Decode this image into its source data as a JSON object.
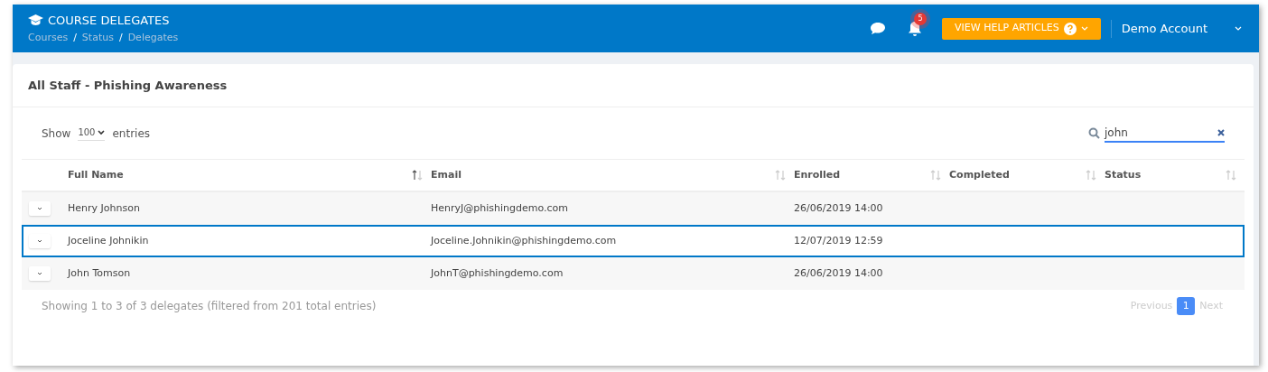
{
  "header": {
    "title": "COURSE DELEGATES",
    "breadcrumbs": [
      "Courses",
      "Status",
      "Delegates"
    ],
    "breadcrumb_separator": "/",
    "notifications": "5",
    "help_button": "VIEW HELP ARTICLES",
    "account": "Demo Account"
  },
  "card": {
    "title": "All Staff - Phishing Awareness"
  },
  "length": {
    "before": "Show",
    "value": "100",
    "after": "entries"
  },
  "search": {
    "value": "john"
  },
  "table": {
    "columns": [
      {
        "label": "Full Name",
        "sorted": true
      },
      {
        "label": "Email",
        "sorted": false
      },
      {
        "label": "Enrolled",
        "sorted": false
      },
      {
        "label": "Completed",
        "sorted": false
      },
      {
        "label": "Status",
        "sorted": false
      }
    ],
    "rows": [
      {
        "selected": false,
        "cells": [
          "Henry Johnson",
          "HenryJ@phishingdemo.com",
          "26/06/2019 14:00"
        ]
      },
      {
        "selected": true,
        "cells": [
          "Joceline Johnikin",
          "Joceline.Johnikin@phishingdemo.com",
          "12/07/2019 12:59"
        ]
      },
      {
        "selected": false,
        "cells": [
          "John Tomson",
          "JohnT@phishingdemo.com",
          "26/06/2019 14:00"
        ]
      }
    ]
  },
  "info": "Showing 1 to 3 of 3 delegates (filtered from 201 total entries)",
  "pagination": {
    "previous": "Previous",
    "pages": [
      {
        "label": "1",
        "selected": true
      }
    ],
    "next": "Next"
  }
}
